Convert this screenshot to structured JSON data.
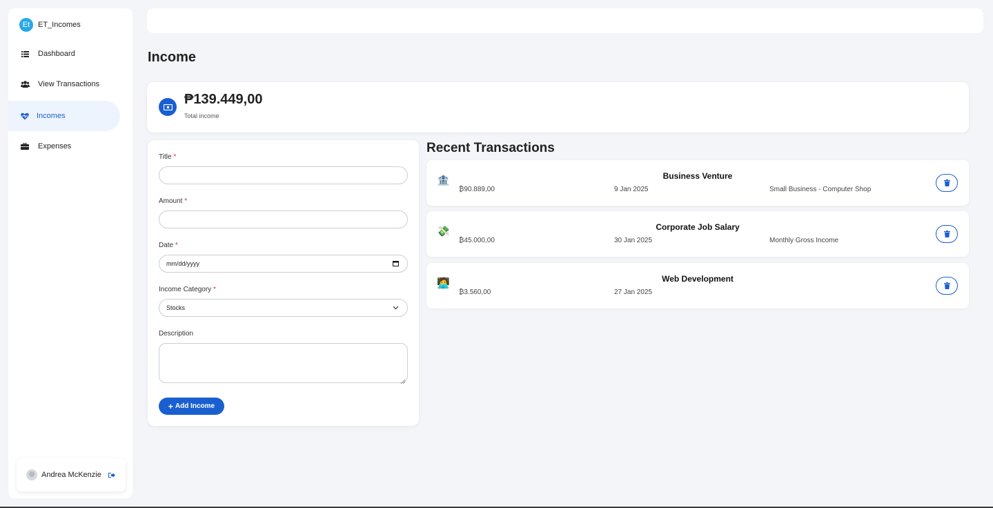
{
  "brand": {
    "badge": "Et",
    "name": "ET_Incomes"
  },
  "sidebar": {
    "items": [
      {
        "label": "Dashboard",
        "icon": "list-icon"
      },
      {
        "label": "View Transactions",
        "icon": "users-icon"
      },
      {
        "label": "Incomes",
        "icon": "heart-pulse-icon",
        "active": true
      },
      {
        "label": "Expenses",
        "icon": "briefcase-icon"
      }
    ],
    "user": {
      "name": "Andrea McKenzie"
    }
  },
  "page": {
    "title": "Income"
  },
  "total": {
    "amount": "₱139.449,00",
    "label": "Total income"
  },
  "form": {
    "title_label": "Title",
    "amount_label": "Amount",
    "date_label": "Date",
    "date_placeholder": "mm/dd/yyyy",
    "category_label": "Income Category",
    "category_value": "Stocks",
    "description_label": "Description",
    "required_mark": "*",
    "submit_label": "Add Income",
    "submit_icon": "+"
  },
  "recent": {
    "title": "Recent Transactions",
    "items": [
      {
        "icon": "🏦",
        "title": "Business Venture",
        "amount": "₿90.889,00",
        "date": "9 Jan 2025",
        "description": "Small Business - Computer Shop"
      },
      {
        "icon": "💸",
        "title": "Corporate Job Salary",
        "amount": "₿45.000,00",
        "date": "30 Jan 2025",
        "description": "Monthly Gross Income"
      },
      {
        "icon": "🧑‍💻",
        "title": "Web Development",
        "amount": "₿3.560,00",
        "date": "27 Jan 2025",
        "description": ""
      }
    ]
  },
  "colors": {
    "accent": "#1a5fd0",
    "brand_badge": "#29a8e6",
    "background": "#f3f5f8"
  }
}
